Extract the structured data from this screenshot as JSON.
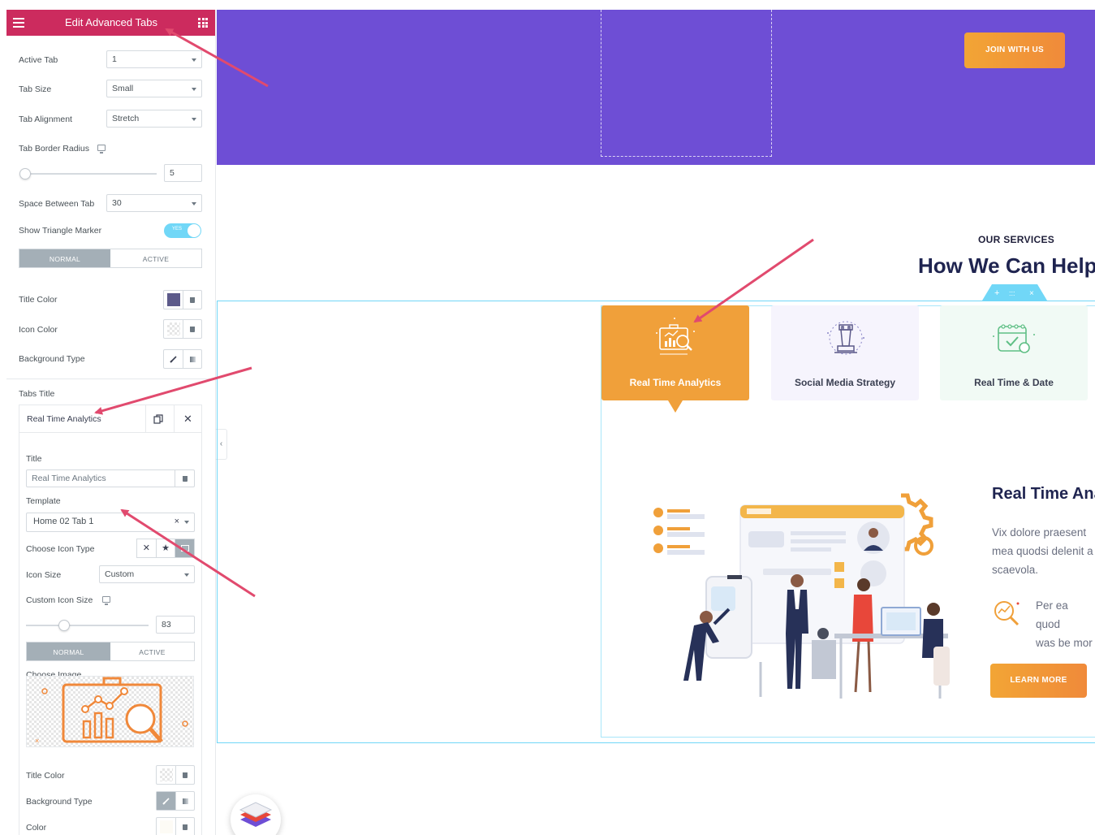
{
  "panel": {
    "title": "Edit Advanced Tabs",
    "controls": {
      "active_tab": {
        "label": "Active Tab",
        "value": "1"
      },
      "tab_size": {
        "label": "Tab Size",
        "value": "Small"
      },
      "tab_alignment": {
        "label": "Tab Alignment",
        "value": "Stretch"
      },
      "tab_border_radius": {
        "label": "Tab Border Radius",
        "value": "5"
      },
      "space_between_tab": {
        "label": "Space Between Tab",
        "value": "30"
      },
      "show_triangle_marker": {
        "label": "Show Triangle Marker",
        "toggle_text": "YES",
        "on": true
      },
      "state_tabs": {
        "normal": "NORMAL",
        "active": "ACTIVE"
      },
      "title_color": {
        "label": "Title Color",
        "swatch": "#5c5a8a"
      },
      "icon_color": {
        "label": "Icon Color"
      },
      "background_type": {
        "label": "Background Type"
      }
    },
    "tabs_title": {
      "label": "Tabs Title",
      "item": {
        "name": "Real Time Analytics",
        "title_label": "Title",
        "title_value": "Real Time Analytics",
        "template_label": "Template",
        "template_value": "Home 02 Tab 1",
        "choose_icon_type_label": "Choose Icon Type",
        "icon_size_label": "Icon Size",
        "icon_size_value": "Custom",
        "custom_icon_size_label": "Custom Icon Size",
        "custom_icon_size_value": "83",
        "state_tabs": {
          "normal": "NORMAL",
          "active": "ACTIVE"
        },
        "choose_image_label": "Choose Image",
        "title_color_label": "Title Color",
        "background_type_label": "Background Type",
        "color_label": "Color"
      }
    }
  },
  "preview": {
    "hero": {
      "button": "JOIN WITH US",
      "bg": "#6e4ed5"
    },
    "section": {
      "eyebrow": "OUR SERVICES",
      "heading": "How We Can Help",
      "tabs": [
        {
          "label": "Real Time Analytics",
          "state": "active",
          "icon": "analytics-icon"
        },
        {
          "label": "Social Media Strategy",
          "state": "normal",
          "icon": "chess-rook-icon"
        },
        {
          "label": "Real Time & Date",
          "state": "normal",
          "icon": "calendar-icon"
        }
      ],
      "content": {
        "title": "Real Time Analytics",
        "paragraph": "Vix dolore praesent\nmea quodsi delenit a\nscaevola.",
        "sub": "Per ea quod\nwas be mor",
        "button": "LEARN MORE"
      }
    },
    "accent": "#f0a03a"
  }
}
